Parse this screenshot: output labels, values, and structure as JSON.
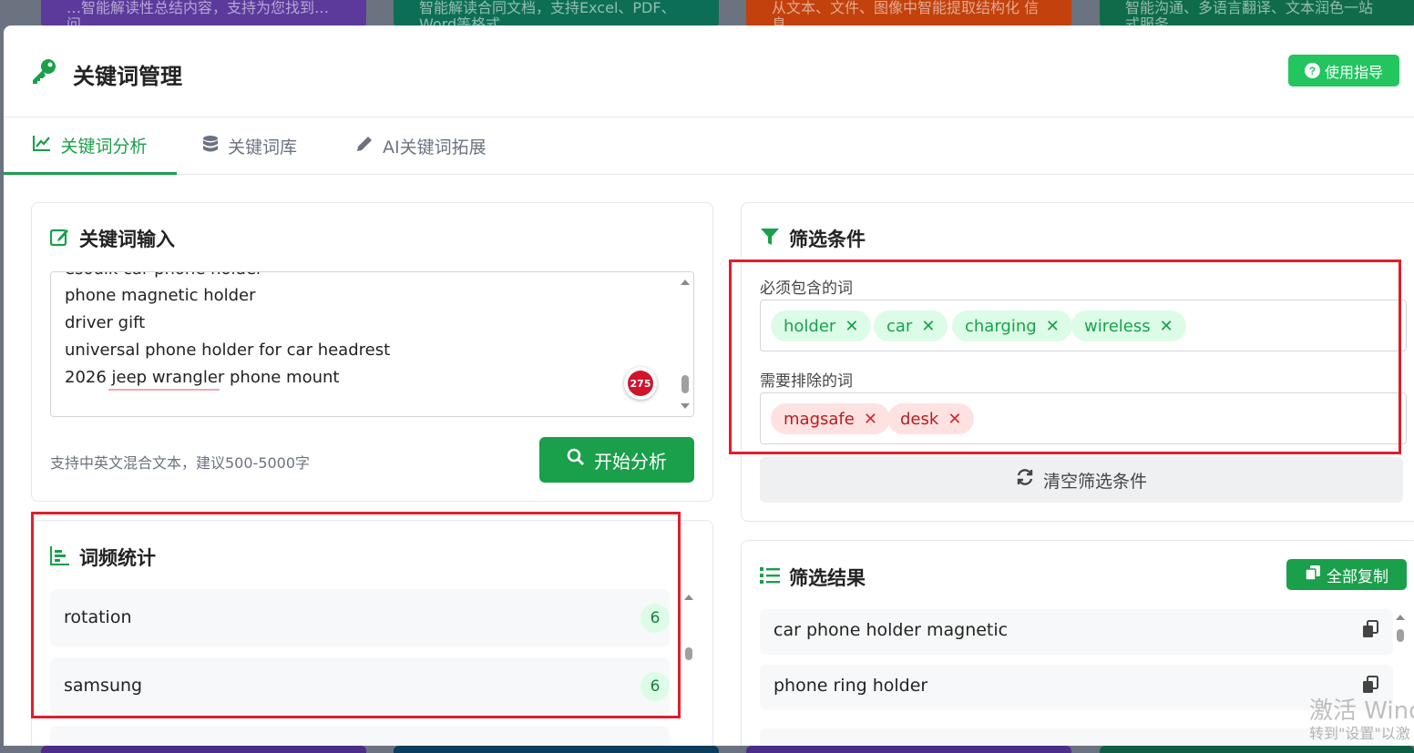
{
  "background_cards": {
    "top": [
      {
        "text": "…智能解读性总结内容，支持为您找到…\n问",
        "color": "#5b3a9c"
      },
      {
        "text": "智能解读合同文档，支持Excel、PDF、\nWord等格式",
        "color": "#0d6e56"
      },
      {
        "text": "从文本、文件、图像中智能提取结构化\n信息",
        "color": "#c2410c"
      },
      {
        "text": "智能沟通、多语言翻译、文本润色一站\n式服务",
        "color": "#0f6b4a"
      }
    ]
  },
  "header": {
    "title": "关键词管理",
    "guide_label": "使用指导"
  },
  "tabs": [
    {
      "label": "关键词分析",
      "active": true
    },
    {
      "label": "关键词库",
      "active": false
    },
    {
      "label": "AI关键词拓展",
      "active": false
    }
  ],
  "input_card": {
    "title": "关键词输入",
    "lines": [
      "esoulk car phone holder",
      "phone magnetic holder",
      "driver gift",
      "universal phone holder for car headrest",
      "2026 jeep wrangler phone mount"
    ],
    "badge_count": "275",
    "hint": "支持中英文混合文本，建议500-5000字",
    "analyze_label": "开始分析"
  },
  "freq_card": {
    "title": "词频统计",
    "items": [
      {
        "word": "rotation",
        "count": "6"
      },
      {
        "word": "samsung",
        "count": "6"
      }
    ]
  },
  "filter_card": {
    "title": "筛选条件",
    "include_label": "必须包含的词",
    "include_tags": [
      "holder",
      "car",
      "charging",
      "wireless"
    ],
    "exclude_label": "需要排除的词",
    "exclude_tags": [
      "magsafe",
      "desk"
    ],
    "clear_label": "清空筛选条件"
  },
  "result_card": {
    "title": "筛选结果",
    "copy_all_label": "全部复制",
    "items": [
      "car phone holder magnetic",
      "phone ring holder"
    ]
  },
  "watermark": {
    "line1": "激活 Windo",
    "line2": "转到\"设置\"以激"
  },
  "colors": {
    "accent": "#1a9f4a",
    "accent_light": "#22c55e",
    "highlight_frame": "#e11d2a",
    "exclude_tag": "#dc2626"
  }
}
